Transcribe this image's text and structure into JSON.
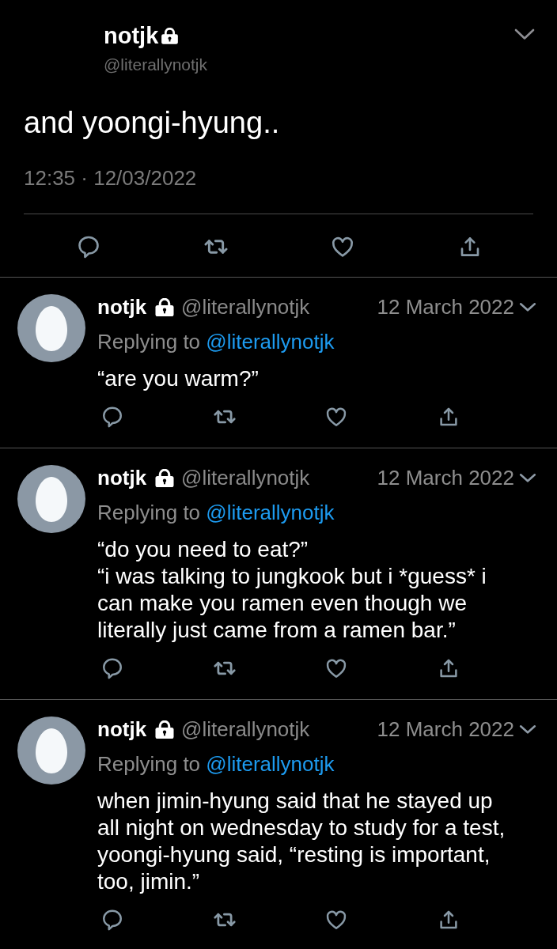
{
  "main_tweet": {
    "name": "notjk",
    "protected": true,
    "handle": "@literallynotjk",
    "text": "and yoongi-hyung..",
    "timestamp": "12:35 · 12/03/2022"
  },
  "replies": [
    {
      "name": "notjk",
      "protected": true,
      "handle": "@literallynotjk",
      "date": "12 March 2022",
      "replying_label": "Replying to",
      "replying_handle": "@literallynotjk",
      "text": "“are you warm?”"
    },
    {
      "name": "notjk",
      "protected": true,
      "handle": "@literallynotjk",
      "date": "12 March 2022",
      "replying_label": "Replying to",
      "replying_handle": "@literallynotjk",
      "text": "“do you need to eat?”\n“i was talking to jungkook but i *guess* i can make you ramen even though we literally just came from a ramen bar.”"
    },
    {
      "name": "notjk",
      "protected": true,
      "handle": "@literallynotjk",
      "date": "12 March 2022",
      "replying_label": "Replying to",
      "replying_handle": "@literallynotjk",
      "text": "when jimin-hyung said that he stayed up all night on wednesday to study for a test, yoongi-hyung said, “resting is important, too, jimin.”"
    }
  ]
}
